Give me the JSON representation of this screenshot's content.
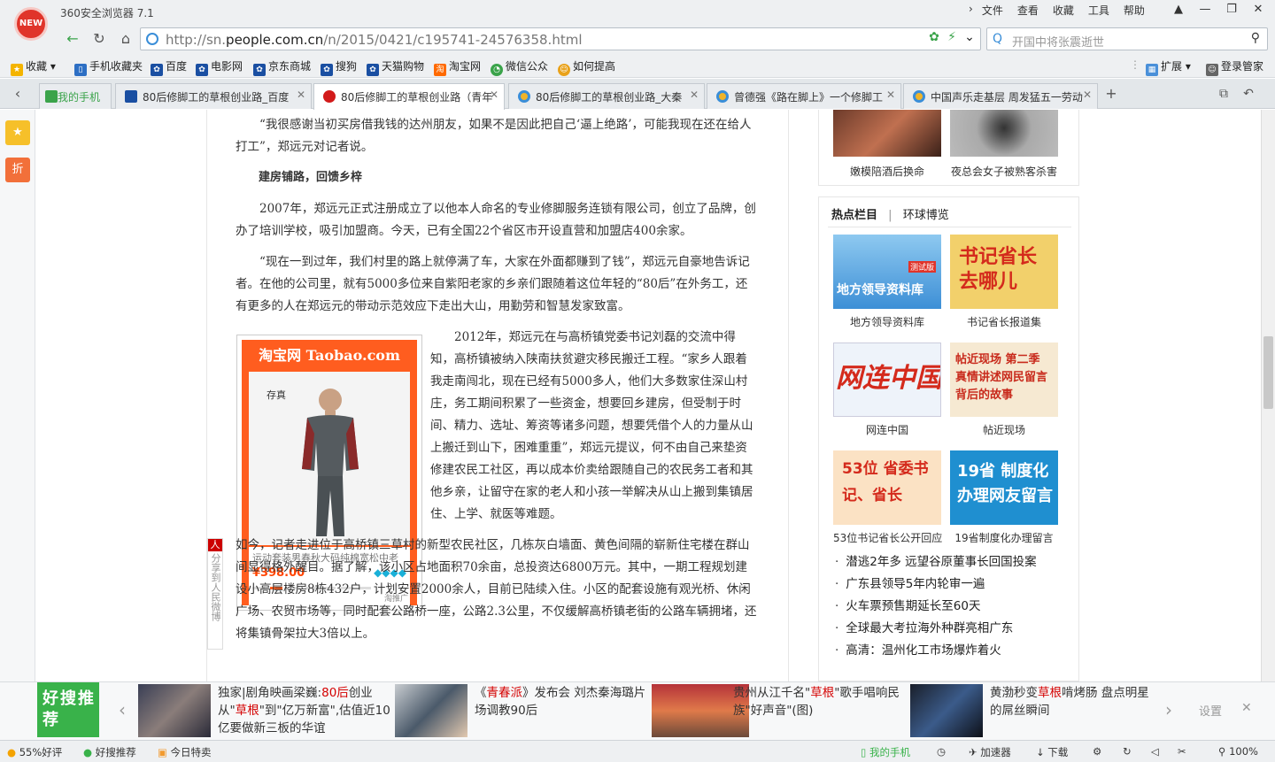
{
  "app": {
    "title": "360安全浏览器 7.1",
    "logo_text": "NEW"
  },
  "menu": [
    "文件",
    "查看",
    "收藏",
    "工具",
    "帮助"
  ],
  "nav": {
    "url_host_prefix": "http://sn.",
    "url_host": "people.com.cn",
    "url_path": "/n/2015/0421/c195741-24576358.html",
    "search_placeholder": "开国中将张震逝世"
  },
  "bookmarks": {
    "collect": "收藏",
    "items": [
      "手机收藏夹",
      "百度",
      "电影网",
      "京东商城",
      "搜狗",
      "天猫购物",
      "淘宝网",
      "微信公众",
      "如何提高"
    ],
    "extend": "扩展",
    "login": "登录管家"
  },
  "tabs": {
    "phone": "我的手机",
    "items": [
      {
        "label": "80后修脚工的草根创业路_百度"
      },
      {
        "label": "80后修脚工的草根创业路（青年"
      },
      {
        "label": "80后修脚工的草根创业路_大秦"
      },
      {
        "label": "曾德强《路在脚上》一个修脚工"
      },
      {
        "label": "中国声乐走基层 周发猛五一劳动"
      }
    ],
    "new_tab": "+"
  },
  "sidebar": {
    "favorites": "★",
    "discount": "折",
    "add": "+"
  },
  "article": {
    "p0": "“我很感谢当初买房借我钱的达州朋友，如果不是因此把自己‘逼上绝路’，可能我现在还在给人打工”，郑远元对记者说。",
    "subheading": "建房铺路，回馈乡梓",
    "p1": "2007年，郑远元正式注册成立了以他本人命名的专业修脚服务连锁有限公司，创立了品牌，创办了培训学校，吸引加盟商。今天，已有全国22个省区市开设直营和加盟店400余家。",
    "p2": "“现在一到过年，我们村里的路上就停满了车，大家在外面都赚到了钱”，郑远元自豪地告诉记者。在他的公司里，就有5000多位来自紫阳老家的乡亲们跟随着这位年轻的“80后”在外务工，还有更多的人在郑远元的带动示范效应下走出大山，用勤劳和智慧发家致富。",
    "p3": "2012年，郑远元在与高桥镇党委书记刘磊的交流中得知，高桥镇被纳入陕南扶贫避灾移民搬迁工程。“家乡人跟着我走南闯北，现在已经有5000多人，他们大多数家住深山村庄，务工期间积累了一些资金，想要回乡建房，但受制于时间、精力、选址、筹资等诸多问题，想要凭借个人的力量从山上搬迁到山下，困难重重”，郑远元提议，何不由自己来垫资修建农民工社区，再以成本价卖给跟随自己的农民务工者和其他乡亲，让留守在家的老人和小孩一举解决从山上搬到集镇居住、上学、就医等难题。",
    "p4": "如今，记者走进位于高桥镇三草村的新型农民社区，几栋灰白墙面、黄色间隔的崭新住宅楼在群山间显得格外醒目。据了解，该小区占地面积70余亩，总投资达6800万元。其中，一期工程规划建设小高层楼房8栋432户，计划安置2000余人，目前已陆续入住。小区的配套设施有观光桥、休闲广场、农贸市场等，同时配套公路桥一座，公路2.3公里，不仅缓解高桥镇老街的公路车辆拥堵，还将集镇骨架拉大3倍以上。",
    "share": "分享到人民微博"
  },
  "ad": {
    "title": "淘宝网 Taobao.com",
    "brand": "存真",
    "desc": "运动套装男春秋大码纯棉宽松中老",
    "price": "¥398.00",
    "tag": "淘推广"
  },
  "right": {
    "top_caps": [
      "嫩模陪酒后换命",
      "夜总会女子被熟客杀害"
    ],
    "hot_title": "热点栏目",
    "hot_sub": "环球博览",
    "tiles": [
      {
        "img_text": "地方领导资料库",
        "img_badge": "测试版",
        "caption": "地方领导资料库",
        "bg": "#3d8fd6"
      },
      {
        "img_text": "书记省长去哪儿",
        "caption": "书记省长报道集",
        "bg": "#f2d06b"
      },
      {
        "img_text": "网连中国",
        "caption": "网连中国",
        "bg": "#eef3fa"
      },
      {
        "img_text": "帖近现场 第二季 真情讲述网民留言背后的故事",
        "caption": "帖近现场",
        "bg": "#f6e9d2"
      },
      {
        "img_text": "53位 省委书记、省长",
        "caption": "53位书记省长公开回应",
        "bg": "#fbe2c4"
      },
      {
        "img_text": "19省 制度化办理网友留言",
        "caption": "19省制度化办理留言",
        "bg": "#1f8fd0"
      }
    ],
    "hot_list": [
      "潜逃2年多 远望谷原董事长回国投案",
      "广东县领导5年内轮审一遍",
      "火车票预售期延长至60天",
      "全球最大考拉海外种群亮相广东",
      "高清：温州化工市场爆炸着火"
    ]
  },
  "recommend": {
    "badge": "好搜推荐",
    "items": [
      {
        "pre": "独家|剧角映画梁巍:",
        "hl": "80后",
        "mid": "创业从\"",
        "hl2": "草根",
        "post": "\"到\"亿万新富\",估值近10亿要做新三板的华谊"
      },
      {
        "pre": "《",
        "hl": "青春派",
        "mid": "》发布会 刘杰秦海璐片场调教90后",
        "hl2": "",
        "post": ""
      },
      {
        "pre": "贵州从江千名\"",
        "hl": "草根",
        "mid": "\"歌手唱响民族\"好声音\"(图)",
        "hl2": "",
        "post": ""
      },
      {
        "pre": "黄渤秒变",
        "hl": "草根",
        "mid": "啃烤肠 盘点明星的屌丝瞬间",
        "hl2": "",
        "post": ""
      }
    ],
    "settings": "设置"
  },
  "status": {
    "rating": "55%好评",
    "haosou": "好搜推荐",
    "today": "今日特卖",
    "phone": "我的手机",
    "accel": "加速器",
    "download": "下载",
    "zoom": "100%"
  },
  "colors": {
    "accent": "#39b24a",
    "brand_red": "#e0342a",
    "taobao": "#ff5d1f",
    "highlight": "#d40000"
  }
}
